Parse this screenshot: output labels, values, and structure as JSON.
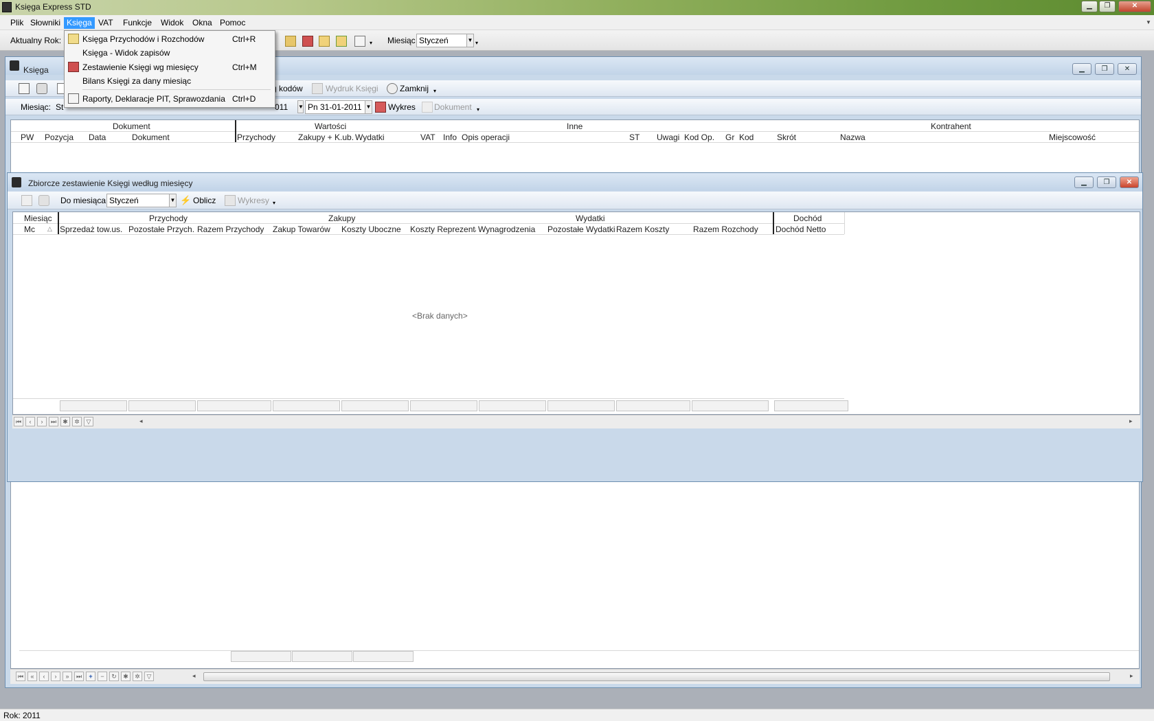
{
  "window": {
    "title": "Księga Express STD"
  },
  "menubar": {
    "items": [
      "Plik",
      "Słowniki",
      "Księga",
      "VAT",
      "Funkcje",
      "Widok",
      "Okna",
      "Pomoc"
    ]
  },
  "toolbar": {
    "year_label": "Aktualny Rok:",
    "month_label": "Miesiąc",
    "month_value": "Styczeń"
  },
  "dropdown": {
    "items": [
      {
        "label": "Księga Przychodów i Rozchodów",
        "shortcut": "Ctrl+R"
      },
      {
        "label": "Księga - Widok zapisów",
        "shortcut": ""
      },
      {
        "label": "Zestawienie Księgi wg miesięcy",
        "shortcut": "Ctrl+M"
      },
      {
        "label": "Bilans Księgi za dany miesiąc",
        "shortcut": ""
      },
      {
        "label": "Raporty, Deklaracje PIT, Sprawozdania",
        "shortcut": "Ctrl+D"
      }
    ]
  },
  "ksiega": {
    "title": "Księga",
    "toolbar": {
      "codes_label": "g kodów",
      "print_label": "Wydruk Księgi",
      "close_label": "Zamknij"
    },
    "filter": {
      "month_label": "Miesiąc:",
      "month_value": "St",
      "date_from_tail": "011",
      "date_to": "Pn 31-01-2011",
      "chart_label": "Wykres",
      "document_label": "Dokument"
    },
    "groups": [
      "Dokument",
      "Wartości",
      "Inne",
      "Kontrahent"
    ],
    "columns": [
      "PW",
      "Pozycja",
      "Data",
      "Dokument",
      "Przychody",
      "Zakupy + K.ub.",
      "Wydatki",
      "VAT",
      "Info",
      "Opis operacji",
      "ST",
      "Uwagi",
      "Kod Op.",
      "Gr",
      "Kod",
      "Skrót",
      "Nazwa",
      "Miejscowość"
    ]
  },
  "zestawienie": {
    "title": "Zbiorcze zestawienie Księgi według miesięcy",
    "toolbar": {
      "to_month_label": "Do miesiąca",
      "month_value": "Styczeń",
      "calc_label": "Oblicz",
      "charts_label": "Wykresy"
    },
    "groups": [
      "Miesiąc",
      "Przychody",
      "Zakupy",
      "Wydatki",
      "Dochód"
    ],
    "columns": [
      "Mc",
      "Sprzedaż tow.us.",
      "Pozostałe Przych.",
      "Razem Przychody",
      "Zakup Towarów",
      "Koszty Uboczne",
      "Koszty Reprezentac",
      "Wynagrodzenia",
      "Pozostałe Wydatki",
      "Razem Koszty",
      "Razem Rozchody",
      "Dochód Netto"
    ],
    "empty_text": "<Brak danych>"
  },
  "statusbar": {
    "text": "Rok: 2011"
  }
}
